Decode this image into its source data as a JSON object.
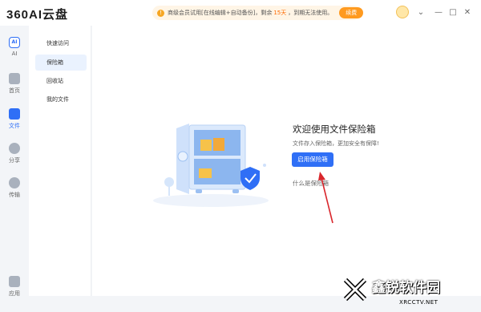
{
  "app": {
    "logo": "360AI云盘"
  },
  "promo": {
    "text": "商级会员试用[在线编辑+自动备份]，剩余",
    "days": "15天",
    "after": "，到期无法使用。",
    "renew_label": "续费"
  },
  "window_controls": [
    "⌄",
    "—",
    "□",
    "✕"
  ],
  "leftnav": {
    "items": [
      {
        "label": "AI",
        "icon": "ai-icon"
      },
      {
        "label": "首页",
        "icon": "home-icon"
      },
      {
        "label": "文件",
        "icon": "folder-icon"
      },
      {
        "label": "分享",
        "icon": "share-icon"
      },
      {
        "label": "传输",
        "icon": "transfer-icon"
      },
      {
        "label": "应用",
        "icon": "apps-icon"
      }
    ]
  },
  "subnav": {
    "items": [
      {
        "label": "快速访问"
      },
      {
        "label": "保险箱",
        "active": true
      },
      {
        "label": "回收站"
      },
      {
        "label": "我的文件"
      }
    ]
  },
  "main": {
    "headline": "欢迎使用文件保险箱",
    "subtext": "文件存入保险箱，更加安全有保障!",
    "enable_button": "启用保险箱",
    "what_link": "什么是保险箱"
  },
  "watermark": {
    "title": "鑫锐软件园",
    "sub": "XRCCTV.NET"
  },
  "colors": {
    "accent": "#2f6ff6",
    "promo_orange": "#ff9a1f",
    "annotation_red": "#d9262c"
  }
}
